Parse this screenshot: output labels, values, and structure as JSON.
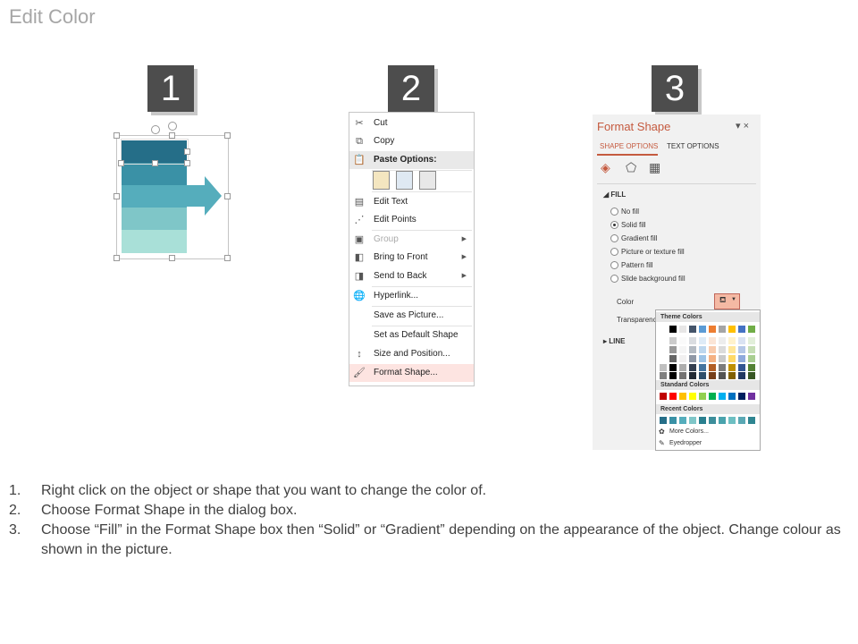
{
  "slide_title": "Edit Color",
  "steps": [
    "1",
    "2",
    "3"
  ],
  "shape_colors": {
    "layer1": "#256e88",
    "layer2": "#3a91a6",
    "layer3": "#55adbc",
    "layer4": "#7fc6c8",
    "layer5": "#a9e0d8"
  },
  "context_menu": {
    "cut": "Cut",
    "copy": "Copy",
    "paste_options": "Paste Options:",
    "edit_text": "Edit Text",
    "edit_points": "Edit Points",
    "group": "Group",
    "bring_to_front": "Bring to Front",
    "send_to_back": "Send to Back",
    "hyperlink": "Hyperlink...",
    "save_as_picture": "Save as Picture...",
    "set_default_shape": "Set as Default Shape",
    "size_and_position": "Size and Position...",
    "format_shape": "Format Shape..."
  },
  "format_pane": {
    "title": "Format Shape",
    "controls": "▾ ×",
    "tab_shape_options": "SHAPE OPTIONS",
    "tab_text_options": "TEXT OPTIONS",
    "fill_section": "FILL",
    "fill_options": [
      "No fill",
      "Solid fill",
      "Gradient fill",
      "Picture or texture fill",
      "Pattern fill",
      "Slide background fill"
    ],
    "selected_fill": "Solid fill",
    "color_label": "Color",
    "transparency_label": "Transparency",
    "line_section": "LINE"
  },
  "color_picker": {
    "theme_colors": "Theme Colors",
    "standard_colors": "Standard Colors",
    "recent_colors": "Recent Colors",
    "more_colors": "More Colors...",
    "eyedropper": "Eyedropper",
    "theme_top": [
      "#ffffff",
      "#000000",
      "#e7e6e6",
      "#44546a",
      "#5b9bd5",
      "#ed7d31",
      "#a5a5a5",
      "#ffc000",
      "#4472c4",
      "#70ad47"
    ],
    "standard": [
      "#c00000",
      "#ff0000",
      "#ffc000",
      "#ffff00",
      "#92d050",
      "#00b050",
      "#00b0f0",
      "#0070c0",
      "#002060",
      "#7030a0"
    ],
    "recent": [
      "#256e88",
      "#3a91a6",
      "#55adbc",
      "#7fc6c8",
      "#2a7f8f",
      "#3d8e9b",
      "#4aa3ad",
      "#6dbfc2",
      "#5aa8b4",
      "#2f8591"
    ]
  },
  "instructions": [
    {
      "num": "1.",
      "text": "Right click on the object or shape that you want to change the color of."
    },
    {
      "num": "2.",
      "text": "Choose Format Shape in the dialog box."
    },
    {
      "num": "3.",
      "text": "Choose “Fill” in the Format Shape box then “Solid” or “Gradient” depending on the appearance of the object. Change colour as shown in the picture."
    }
  ]
}
